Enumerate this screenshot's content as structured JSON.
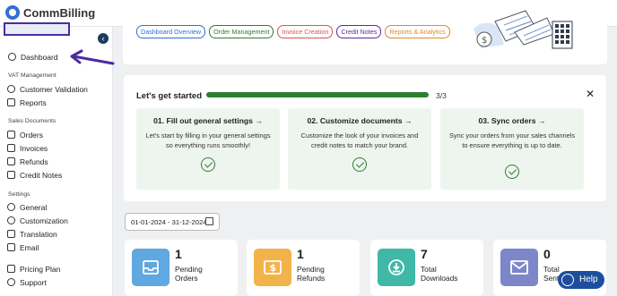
{
  "app": {
    "name": "CommBilling"
  },
  "sidebar": {
    "active": "Dashboard",
    "sections": [
      {
        "label": "",
        "items": [
          {
            "label": "Dashboard",
            "icon": "dashboard-icon"
          }
        ]
      },
      {
        "label": "VAT Management",
        "items": [
          {
            "label": "Customer Validation",
            "icon": "user-check-icon"
          },
          {
            "label": "Reports",
            "icon": "report-icon"
          }
        ]
      },
      {
        "label": "Sales Documents",
        "items": [
          {
            "label": "Orders",
            "icon": "cart-icon"
          },
          {
            "label": "Invoices",
            "icon": "invoice-icon"
          },
          {
            "label": "Refunds",
            "icon": "refund-icon"
          },
          {
            "label": "Credit Notes",
            "icon": "credit-note-icon"
          }
        ]
      },
      {
        "label": "Settings",
        "items": [
          {
            "label": "General",
            "icon": "gear-icon"
          },
          {
            "label": "Customization",
            "icon": "palette-icon"
          },
          {
            "label": "Translation",
            "icon": "translate-icon"
          },
          {
            "label": "Email",
            "icon": "mail-icon"
          }
        ]
      },
      {
        "label": "",
        "items": [
          {
            "label": "Pricing Plan",
            "icon": "tag-icon"
          },
          {
            "label": "Support",
            "icon": "support-icon"
          }
        ]
      }
    ]
  },
  "pills": [
    {
      "label": "Dashboard Overview",
      "color": "#2f6fd8"
    },
    {
      "label": "Order Management",
      "color": "#2e7d32"
    },
    {
      "label": "Invoice Creation",
      "color": "#d9534f"
    },
    {
      "label": "Credit Notes",
      "color": "#5b2ca0"
    },
    {
      "label": "Reports & Analytics",
      "color": "#e08a2c"
    }
  ],
  "getting_started": {
    "title": "Let's get started",
    "progress_text": "3/3",
    "progress_fraction": 1.0,
    "steps": [
      {
        "title": "01. Fill out general settings →",
        "desc": "Let's start by filling in your general settings so everything runs smoothly!"
      },
      {
        "title": "02. Customize documents →",
        "desc": "Customize the look of your invoices and credit notes to match your brand."
      },
      {
        "title": "03. Sync orders →",
        "desc": "Sync your orders from your sales channels to ensure everything is up to date."
      }
    ]
  },
  "date_range": "01-01-2024 - 31-12-2024",
  "stats": [
    {
      "value": "1",
      "line1": "Pending",
      "line2": "Orders",
      "color": "#5fa8e0",
      "icon": "inbox-icon"
    },
    {
      "value": "1",
      "line1": "Pending",
      "line2": "Refunds",
      "color": "#f2b34a",
      "icon": "dollar-icon"
    },
    {
      "value": "7",
      "line1": "Total",
      "line2": "Downloads",
      "color": "#3fb8a8",
      "icon": "download-icon"
    },
    {
      "value": "0",
      "line1": "Total",
      "line2": "Sent",
      "color": "#7c86c9",
      "icon": "mail-check-icon"
    }
  ],
  "help": {
    "label": "Help"
  },
  "colors": {
    "accent": "#2e7d32",
    "brand": "#2f6fd8",
    "highlight": "#4b2ca0"
  }
}
